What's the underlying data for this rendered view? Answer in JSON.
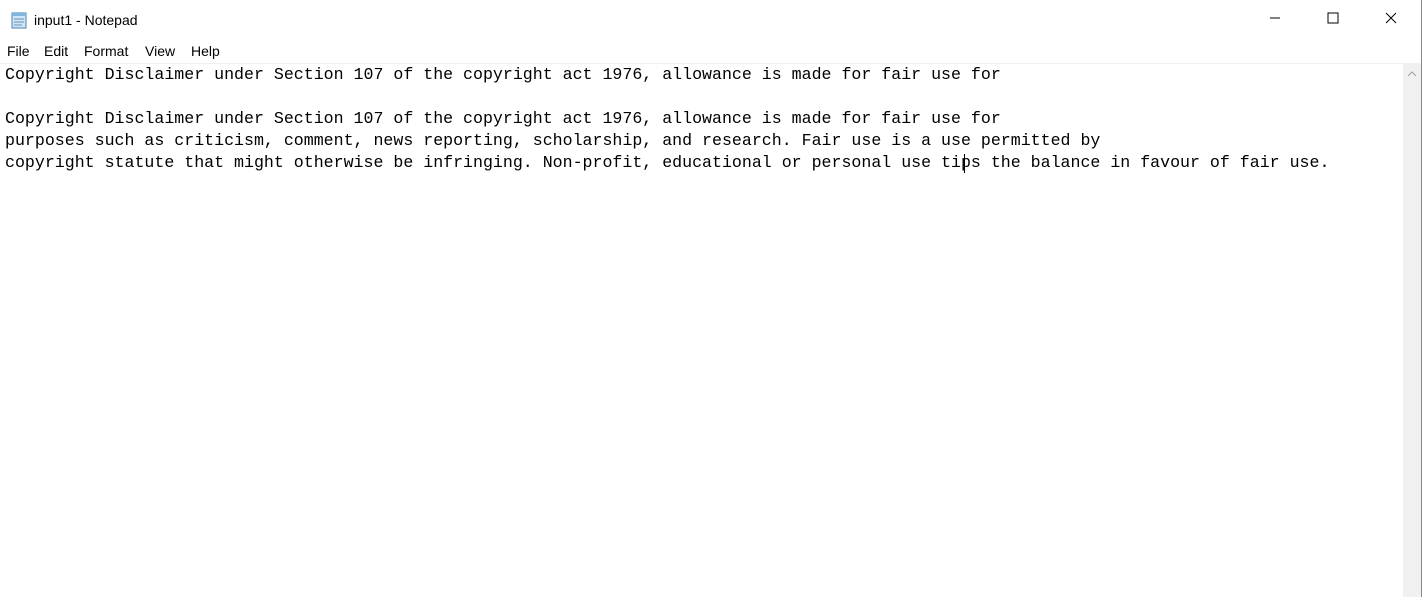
{
  "window": {
    "title": "input1 - Notepad"
  },
  "icons": {
    "app": "notepad-icon",
    "minimize": "minimize-icon",
    "maximize": "maximize-icon",
    "close": "close-icon",
    "scroll_up": "chevron-up-icon"
  },
  "menu": {
    "file": "File",
    "edit": "Edit",
    "format": "Format",
    "view": "View",
    "help": "Help"
  },
  "editor": {
    "lines": [
      "Copyright Disclaimer under Section 107 of the copyright act 1976, allowance is made for fair use for",
      "",
      "Copyright Disclaimer under Section 107 of the copyright act 1976, allowance is made for fair use for",
      "purposes such as criticism, comment, news reporting, scholarship, and research. Fair use is a use permitted by",
      "copyright statute that might otherwise be infringing. Non-profit, educational or personal use tips the balance in favour of fair use."
    ]
  },
  "colors": {
    "window_bg": "#ffffff",
    "text": "#000000",
    "scrollbar_bg": "#f0f0f0"
  }
}
